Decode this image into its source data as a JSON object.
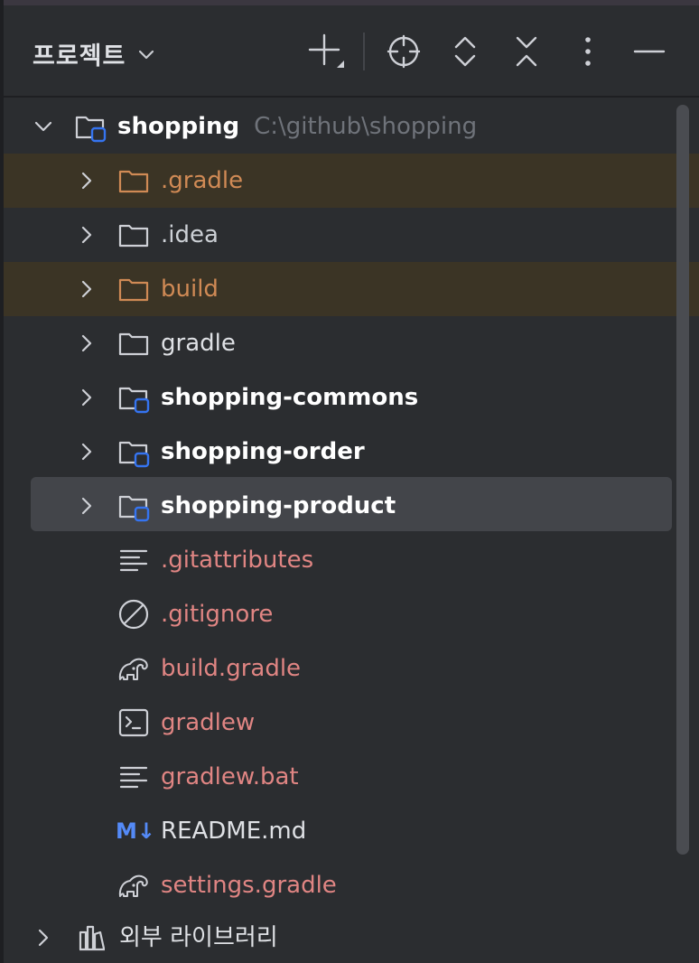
{
  "header": {
    "title": "프로젝트"
  },
  "root": {
    "name": "shopping",
    "path": "C:\\github\\shopping"
  },
  "items": [
    {
      "label": ".gradle",
      "color": "#d08a55"
    },
    {
      "label": ".idea",
      "color": "#cdd1d6"
    },
    {
      "label": "build",
      "color": "#d08a55"
    },
    {
      "label": "gradle",
      "color": "#dfe1e5"
    },
    {
      "label": "shopping-commons",
      "color": "#ffffff"
    },
    {
      "label": "shopping-order",
      "color": "#ffffff"
    },
    {
      "label": "shopping-product",
      "color": "#ffffff"
    },
    {
      "label": ".gitattributes",
      "color": "#e08583"
    },
    {
      "label": ".gitignore",
      "color": "#e08583"
    },
    {
      "label": "build.gradle",
      "color": "#e08583"
    },
    {
      "label": "gradlew",
      "color": "#e08583"
    },
    {
      "label": "gradlew.bat",
      "color": "#e08583"
    },
    {
      "label": "README.md",
      "color": "#dfe1e5",
      "icon_text": "M↓"
    },
    {
      "label": "settings.gradle",
      "color": "#e08583"
    }
  ],
  "external_libraries": {
    "label": "외부 라이브러리"
  },
  "colors": {
    "background": "#2b2d30",
    "ignored_highlight": "#3b3425",
    "selection": "#43454a",
    "module_badge": "#3574f0",
    "markdown_icon": "#548af7"
  }
}
